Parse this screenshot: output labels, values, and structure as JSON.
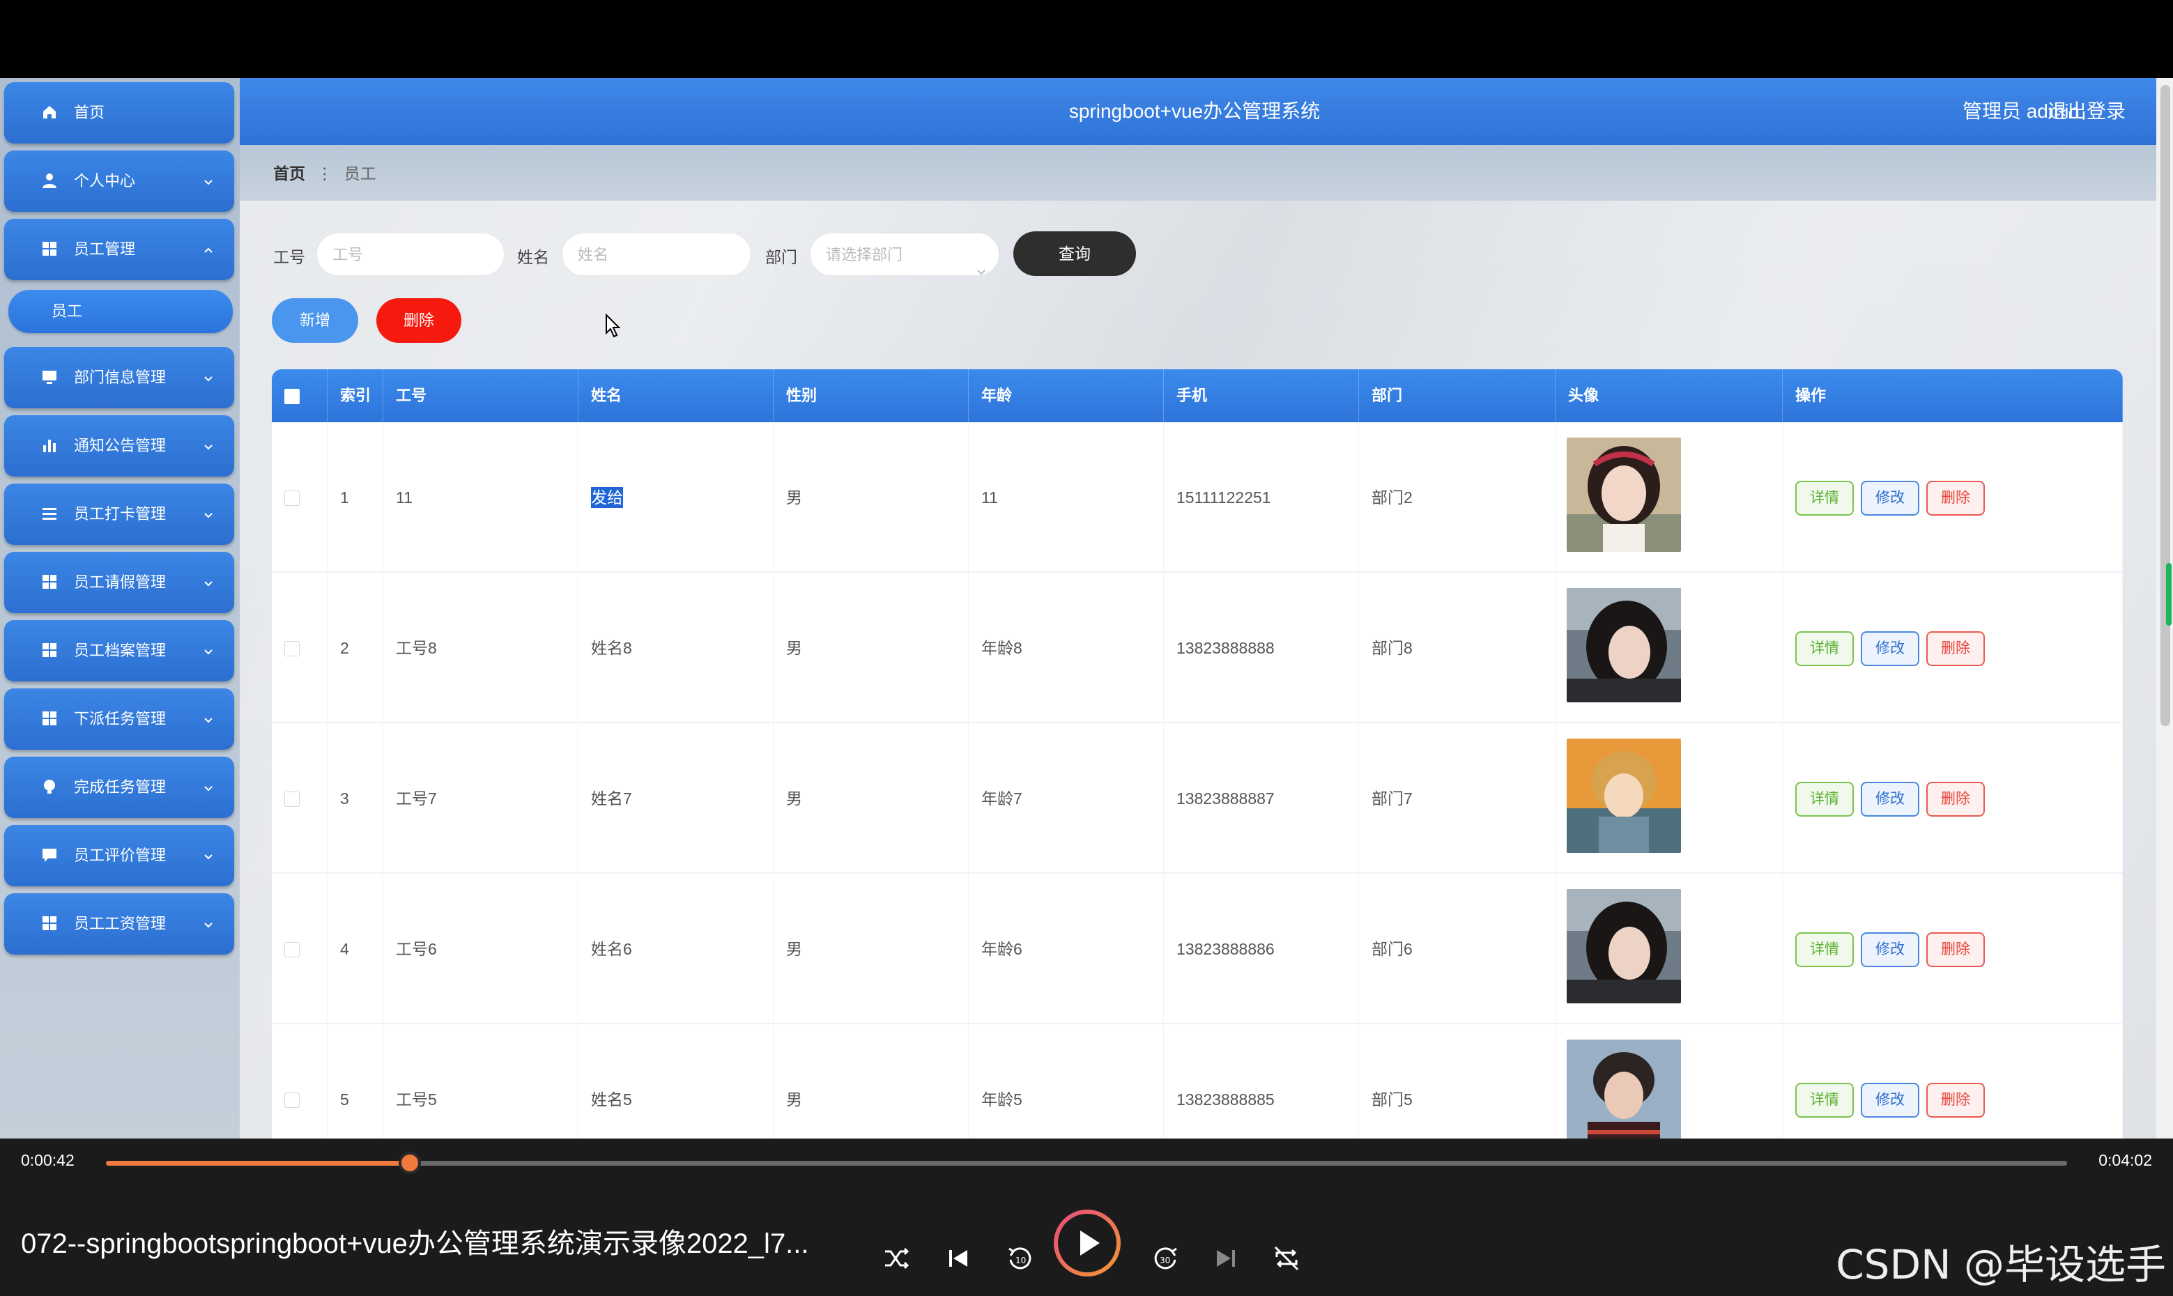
{
  "header": {
    "title": "springboot+vue办公管理系统",
    "user": "管理员 admin",
    "logout": "退出登录"
  },
  "sidebar": {
    "items": [
      {
        "label": "首页",
        "icon": "home-icon"
      },
      {
        "label": "个人中心",
        "icon": "user-icon"
      },
      {
        "label": "员工管理",
        "icon": "grid-icon"
      },
      {
        "label": "部门信息管理",
        "icon": "monitor-icon"
      },
      {
        "label": "通知公告管理",
        "icon": "bar-chart-icon"
      },
      {
        "label": "员工打卡管理",
        "icon": "list-icon"
      },
      {
        "label": "员工请假管理",
        "icon": "grid-icon"
      },
      {
        "label": "员工档案管理",
        "icon": "grid-icon"
      },
      {
        "label": "下派任务管理",
        "icon": "grid-icon"
      },
      {
        "label": "完成任务管理",
        "icon": "bulb-icon"
      },
      {
        "label": "员工评价管理",
        "icon": "chat-icon"
      },
      {
        "label": "员工工资管理",
        "icon": "grid-icon"
      }
    ],
    "sub_item": "员工"
  },
  "breadcrumb": {
    "home": "首页",
    "sep": "⋮",
    "current": "员工"
  },
  "search": {
    "id_label": "工号",
    "id_placeholder": "工号",
    "name_label": "姓名",
    "name_placeholder": "姓名",
    "dept_label": "部门",
    "dept_placeholder": "请选择部门",
    "query": "查询"
  },
  "actions": {
    "add": "新增",
    "delete": "删除"
  },
  "table": {
    "headers": [
      "索引",
      "工号",
      "姓名",
      "性别",
      "年龄",
      "手机",
      "部门",
      "头像",
      "操作"
    ],
    "row_actions": {
      "detail": "详情",
      "edit": "修改",
      "delete": "删除"
    },
    "rows": [
      {
        "index": "1",
        "id": "11",
        "name": "发给",
        "gender": "男",
        "age": "11",
        "phone": "15111122251",
        "dept": "部门2"
      },
      {
        "index": "2",
        "id": "工号8",
        "name": "姓名8",
        "gender": "男",
        "age": "年龄8",
        "phone": "13823888888",
        "dept": "部门8"
      },
      {
        "index": "3",
        "id": "工号7",
        "name": "姓名7",
        "gender": "男",
        "age": "年龄7",
        "phone": "13823888887",
        "dept": "部门7"
      },
      {
        "index": "4",
        "id": "工号6",
        "name": "姓名6",
        "gender": "男",
        "age": "年龄6",
        "phone": "13823888886",
        "dept": "部门6"
      },
      {
        "index": "5",
        "id": "工号5",
        "name": "姓名5",
        "gender": "男",
        "age": "年龄5",
        "phone": "13823888885",
        "dept": "部门5"
      }
    ]
  },
  "player": {
    "current_time": "0:00:42",
    "total_time": "0:04:02",
    "progress": 0.155,
    "title": "072--springbootspringboot+vue办公管理系统演示录像2022_l7...",
    "watermark": "CSDN @毕设选手",
    "accent": "#f07a3c"
  }
}
